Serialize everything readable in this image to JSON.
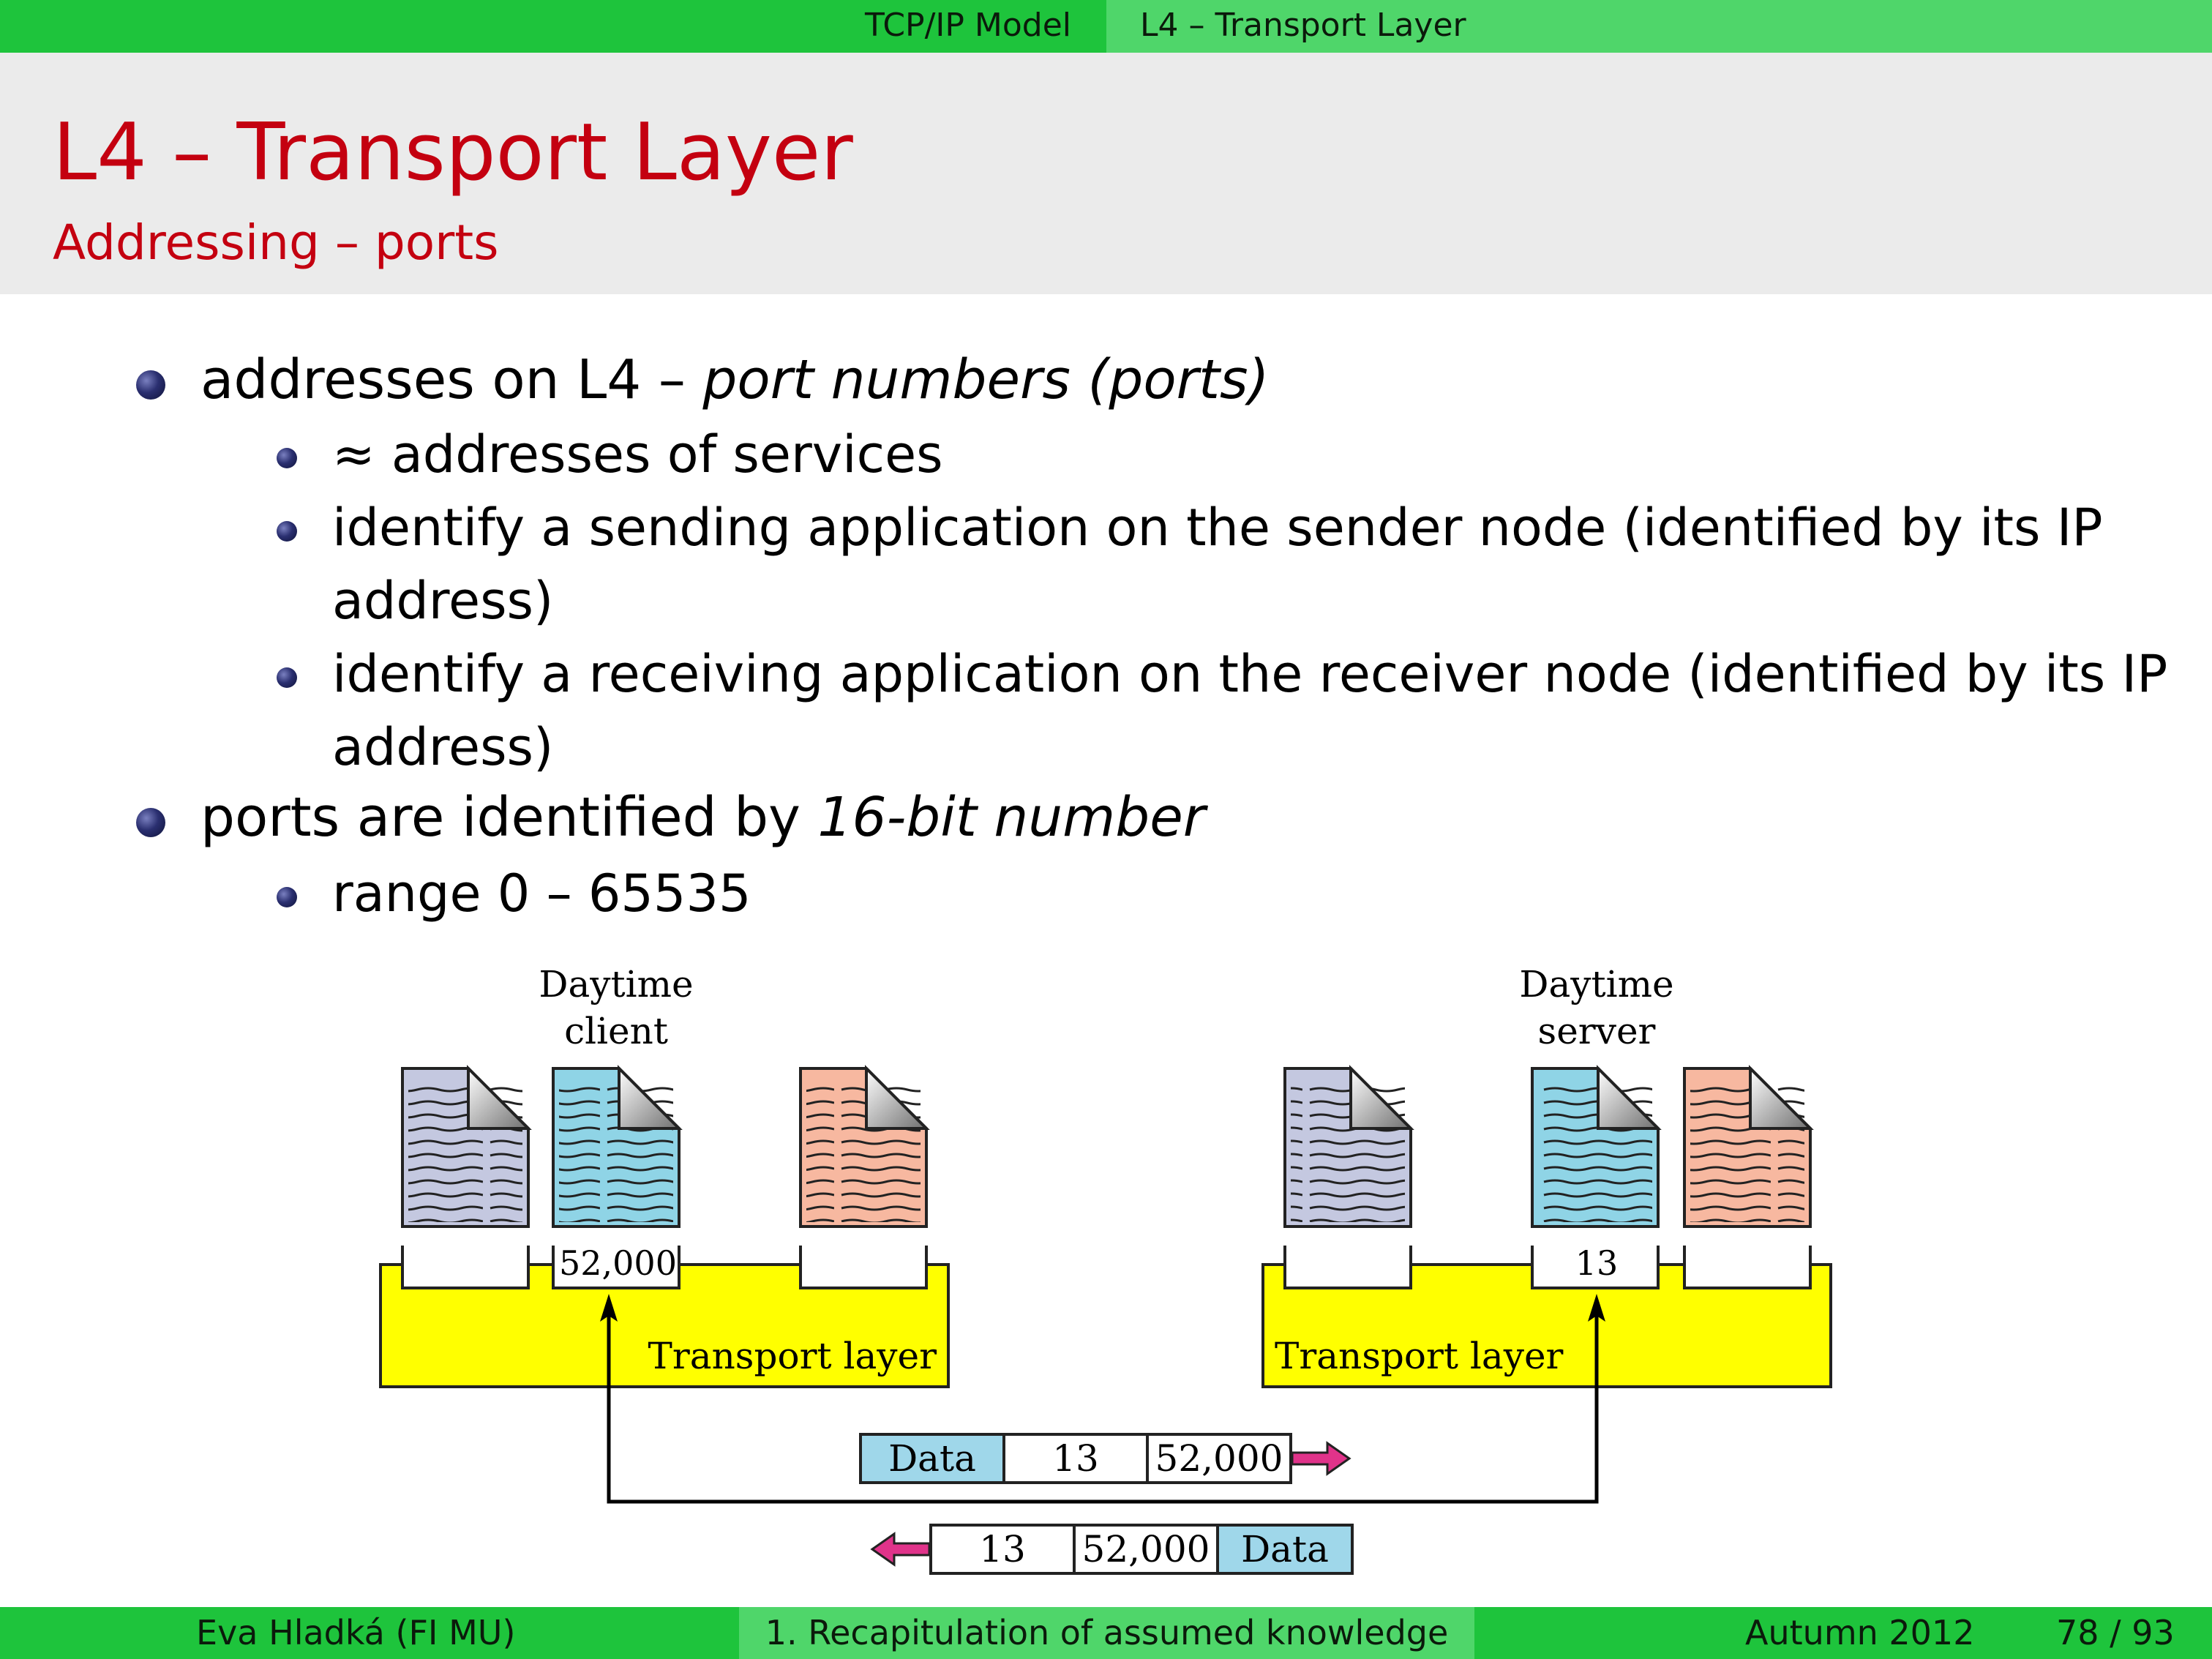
{
  "header": {
    "section": "TCP/IP Model",
    "subsection": "L4 – Transport Layer"
  },
  "slide": {
    "title": "L4 – Transport Layer",
    "subtitle": "Addressing – ports"
  },
  "bullets": {
    "b1_prefix": "addresses on L4 – ",
    "b1_italic": "port numbers (ports)",
    "b1_sub1": "≈ addresses of services",
    "b1_sub2_line1": "identify a sending application on the sender node (identified by its IP",
    "b1_sub2_line2": "address)",
    "b1_sub3_line1": "identify a receiving application on the receiver node (identified by its IP",
    "b1_sub3_line2": "address)",
    "b2_prefix": "ports are identified by ",
    "b2_italic": "16-bit number",
    "b2_sub1": "range 0 – 65535"
  },
  "diagram": {
    "client_label_line1": "Daytime",
    "client_label_line2": "client",
    "server_label_line1": "Daytime",
    "server_label_line2": "server",
    "client_port": "52,000",
    "server_port": "13",
    "layer_label_left": "Transport layer",
    "layer_label_right": "Transport layer",
    "packet_request": [
      "Data",
      "13",
      "52,000"
    ],
    "packet_response": [
      "13",
      "52,000",
      "Data"
    ],
    "colors": {
      "layer": "#ffff00",
      "doc_blue": "#c4c8e0",
      "doc_cyan": "#8fd4e6",
      "doc_salmon": "#f7b8a0",
      "data_cell": "#9fd7ea",
      "arrow": "#e0338a"
    }
  },
  "footer": {
    "author": "Eva Hladká  (FI MU)",
    "lecture": "1. Recapitulation of assumed knowledge",
    "date": "Autumn 2012",
    "page": "78 / 93"
  }
}
